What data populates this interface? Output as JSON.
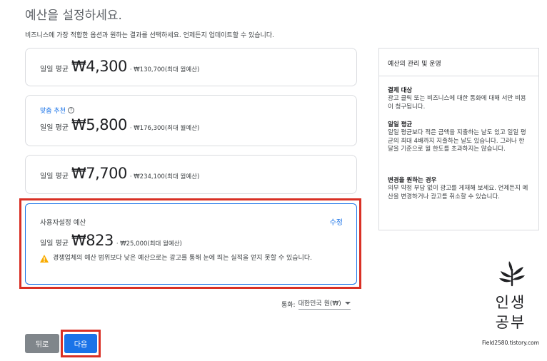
{
  "header": {
    "title": "예산을 설정하세요.",
    "subtitle": "비즈니스에 가장 적합한 옵션과 원하는 결과를 선택하세요. 언제든지 업데이트할 수 있습니다."
  },
  "options": [
    {
      "daily_label": "일일 평균",
      "amount": "₩4,300",
      "monthly": "· ₩130,700(최대 월예산)"
    },
    {
      "recommend_label": "맞춤 추천",
      "daily_label": "일일 평균",
      "amount": "₩5,800",
      "monthly": "· ₩176,300(최대 월예산)"
    },
    {
      "daily_label": "일일 평균",
      "amount": "₩7,700",
      "monthly": "· ₩234,100(최대 월예산)"
    }
  ],
  "custom": {
    "label": "사용자설정 예산",
    "edit_label": "수정",
    "daily_label": "일일 평균",
    "amount": "₩823",
    "monthly": "· ₩25,000(최대 월예산)",
    "warning": "경쟁업체의 예산 범위보다 낮은 예산으로는 광고를 통해 눈에 띄는 실적을 얻지 못할 수 있습니다."
  },
  "side_panel": {
    "title": "예산의 관리 및 운영",
    "sections": [
      {
        "heading": "결제 대상",
        "body": "광고 클릭 또는 비즈니스에 대한 통화에 대해 서만 비용이 청구됩니다."
      },
      {
        "heading": "일일 평균",
        "body": "일일 평균보다 적은 금액을 지출하는 날도 있고 일일 평균의 최대 4배까지 지출하는 날도 있습니다. 그러나 한 달을 기준으로 월 한도를 초과하지는 않습니다."
      },
      {
        "heading": "변경을 원하는 경우",
        "body": "의무 약정 부담 없이 광고를 게재해 보세요. 언제든지 예산을 변경하거나 광고를 취소할 수 있습니다."
      }
    ]
  },
  "currency": {
    "label": "통화:",
    "value": "대한민국 원(₩)"
  },
  "buttons": {
    "back": "뒤로",
    "next": "다음"
  },
  "watermark": {
    "line1": "인생",
    "line2": "공부",
    "url": "Field2580.tistory.com"
  },
  "colors": {
    "accent": "#1a73e8",
    "highlight": "#d93025",
    "warning": "#f9ab00",
    "back_button": "#80868b"
  }
}
